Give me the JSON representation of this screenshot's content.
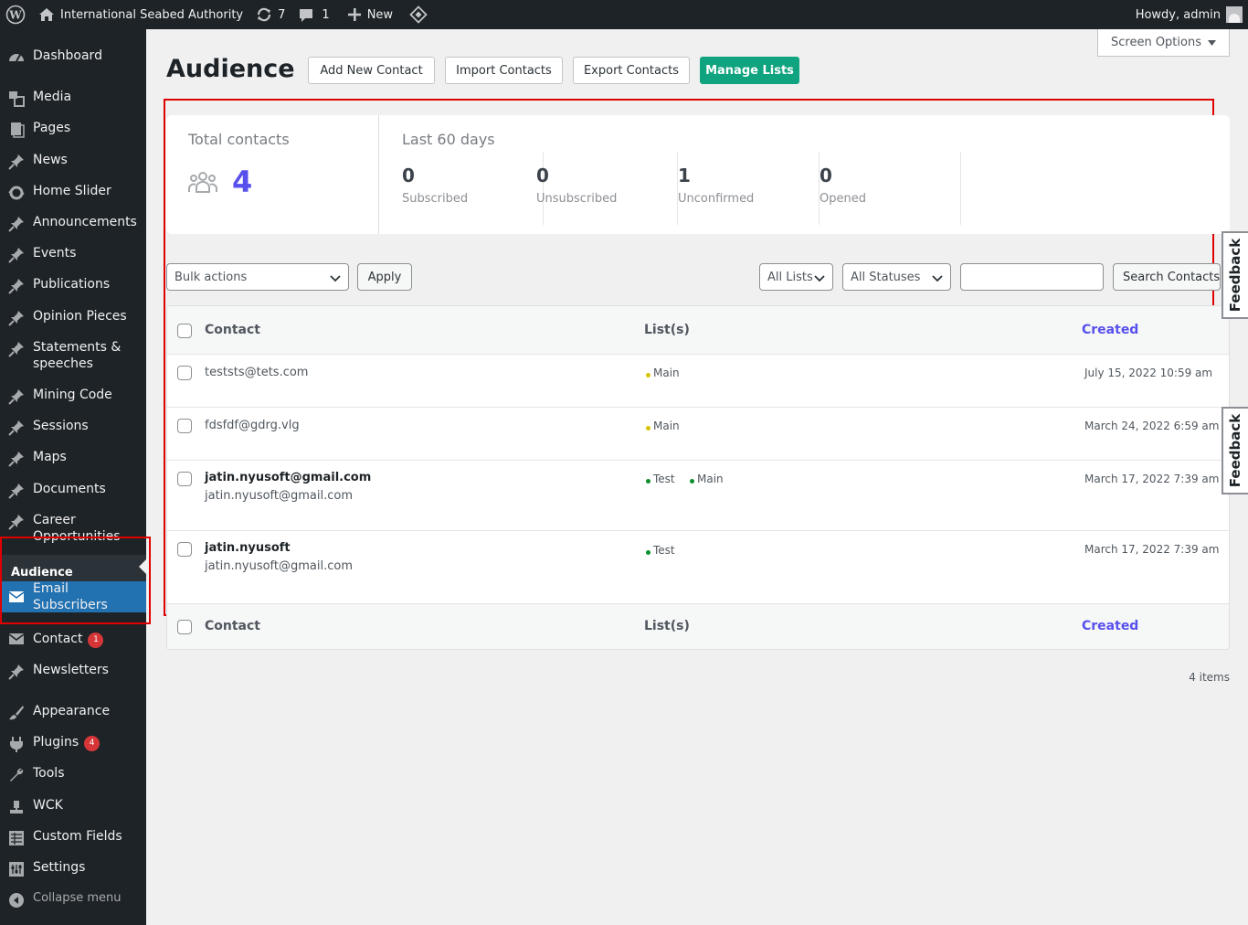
{
  "adminbar": {
    "site_name": "International Seabed Authority",
    "updates_count": "7",
    "comments_count": "1",
    "new_label": "New",
    "howdy": "Howdy, admin"
  },
  "sidebar": {
    "items": [
      {
        "label": "Dashboard",
        "icon": "dashboard-icon"
      },
      {
        "label": "Media",
        "icon": "media-icon"
      },
      {
        "label": "Pages",
        "icon": "pages-icon"
      },
      {
        "label": "News",
        "icon": "pin-icon"
      },
      {
        "label": "Home Slider",
        "icon": "slider-icon"
      },
      {
        "label": "Announcements",
        "icon": "pin-icon"
      },
      {
        "label": "Events",
        "icon": "pin-icon"
      },
      {
        "label": "Publications",
        "icon": "pin-icon"
      },
      {
        "label": "Opinion Pieces",
        "icon": "pin-icon"
      },
      {
        "label": "Statements & speeches",
        "icon": "pin-icon"
      },
      {
        "label": "Mining Code",
        "icon": "pin-icon"
      },
      {
        "label": "Sessions",
        "icon": "pin-icon"
      },
      {
        "label": "Maps",
        "icon": "pin-icon"
      },
      {
        "label": "Documents",
        "icon": "pin-icon"
      },
      {
        "label": "Career Opportunities",
        "icon": "pin-icon"
      },
      {
        "label": "Email Subscribers",
        "icon": "envelope-icon"
      },
      {
        "label": "Contact",
        "icon": "envelope-icon",
        "badge": "1"
      },
      {
        "label": "Newsletters",
        "icon": "pin-icon"
      },
      {
        "label": "Appearance",
        "icon": "brush-icon"
      },
      {
        "label": "Plugins",
        "icon": "plugin-icon",
        "badge": "4"
      },
      {
        "label": "Tools",
        "icon": "wrench-icon"
      },
      {
        "label": "WCK",
        "icon": "wck-icon"
      },
      {
        "label": "Custom Fields",
        "icon": "fields-icon"
      },
      {
        "label": "Settings",
        "icon": "settings-icon"
      },
      {
        "label": "Collapse menu",
        "icon": "collapse-icon"
      }
    ],
    "submenu_current": "Audience"
  },
  "header": {
    "screen_options": "Screen Options",
    "title": "Audience",
    "buttons": [
      "Add New Contact",
      "Import Contacts",
      "Export Contacts",
      "Manage Lists"
    ]
  },
  "stats": {
    "total_title": "Total contacts",
    "total_value": "4",
    "period_title": "Last 60 days",
    "metrics": [
      {
        "value": "0",
        "label": "Subscribed"
      },
      {
        "value": "0",
        "label": "Unsubscribed"
      },
      {
        "value": "1",
        "label": "Unconfirmed"
      },
      {
        "value": "0",
        "label": "Opened"
      }
    ]
  },
  "filters": {
    "bulk_actions": "Bulk actions",
    "apply": "Apply",
    "all_lists": "All Lists",
    "all_statuses": "All Statuses",
    "search_button": "Search Contacts"
  },
  "table": {
    "columns": [
      "Contact",
      "List(s)",
      "Created"
    ],
    "rows": [
      {
        "name": "",
        "email": "teststs@tets.com",
        "lists": [
          {
            "name": "Main",
            "status": "unconfirmed"
          }
        ],
        "created": "July 15, 2022 10:59 am"
      },
      {
        "name": "",
        "email": "fdsfdf@gdrg.vlg",
        "lists": [
          {
            "name": "Main",
            "status": "unconfirmed"
          }
        ],
        "created": "March 24, 2022 6:59 am"
      },
      {
        "name": "jatin.nyusoft@gmail.com",
        "email": "jatin.nyusoft@gmail.com",
        "lists": [
          {
            "name": "Test",
            "status": "subscribed"
          },
          {
            "name": "Main",
            "status": "subscribed"
          }
        ],
        "created": "March 17, 2022 7:39 am"
      },
      {
        "name": "jatin.nyusoft",
        "email": "jatin.nyusoft@gmail.com",
        "lists": [
          {
            "name": "Test",
            "status": "subscribed"
          }
        ],
        "created": "March 17, 2022 7:39 am"
      }
    ],
    "items_count": "4 items"
  },
  "feedback_label": "Feedback",
  "colors": {
    "accent": "#5850ec",
    "primary_button": "#10a37f",
    "dot_unconfirmed": "#d6c400",
    "dot_subscribed": "#0a8f2a",
    "highlight": "#e00000"
  }
}
